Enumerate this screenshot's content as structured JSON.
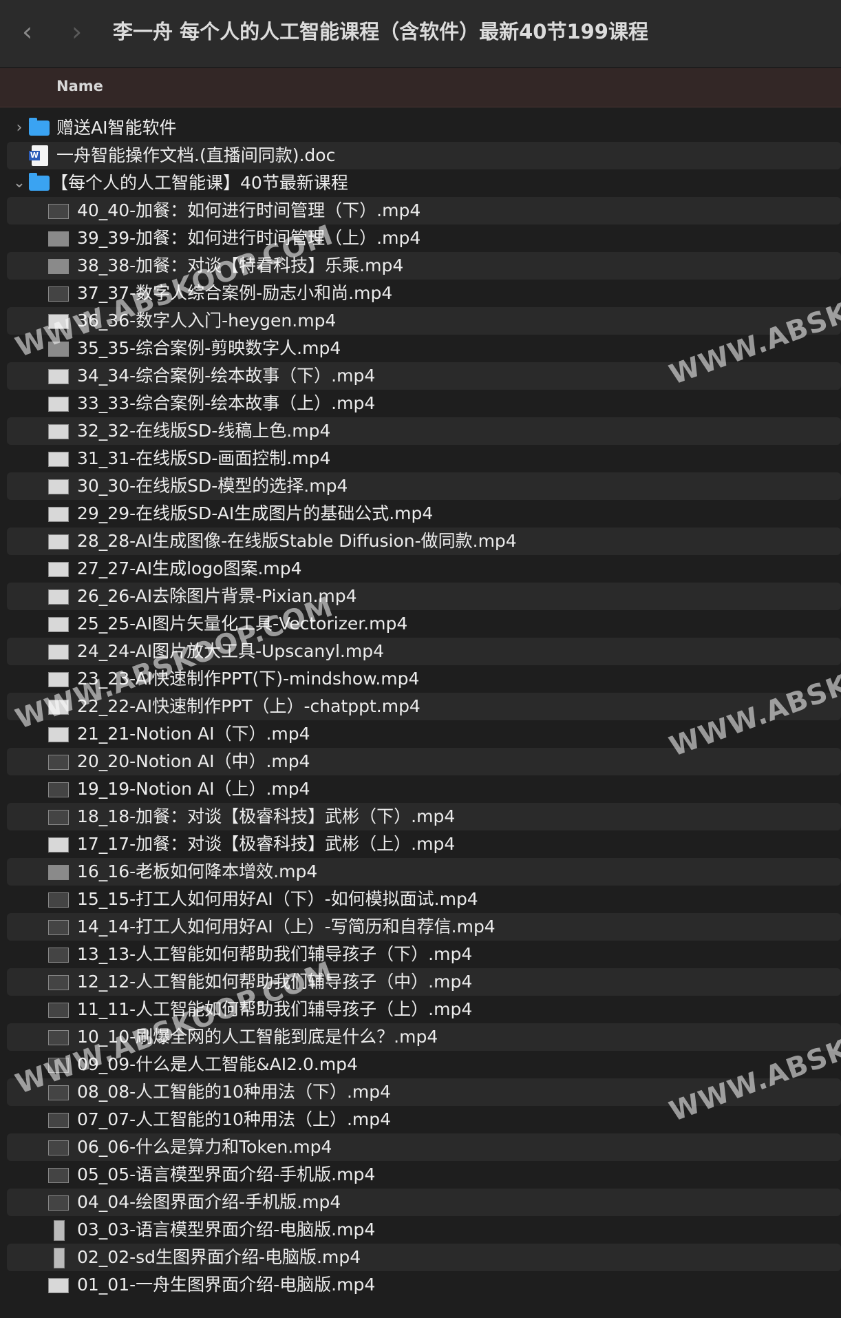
{
  "window": {
    "title": "李一舟 每个人的人工智能课程（含软件）最新40节199课程",
    "back_glyph": "‹",
    "forward_glyph": "›"
  },
  "header": {
    "name_column": "Name"
  },
  "rows": [
    {
      "label": "赠送AI智能软件",
      "kind": "folder",
      "disclosure": "›"
    },
    {
      "label": "一舟智能操作文档.(直播间同款).doc",
      "kind": "doc"
    },
    {
      "label": "【每个人的人工智能课】40节最新课程",
      "kind": "folder",
      "disclosure": "⌄"
    },
    {
      "label": "40_40-加餐：如何进行时间管理（下）.mp4",
      "kind": "video"
    },
    {
      "label": "39_39-加餐：如何进行时间管理（上）.mp4",
      "kind": "video"
    },
    {
      "label": "38_38-加餐：对谈【特看科技】乐乘.mp4",
      "kind": "video"
    },
    {
      "label": "37_37-数字人综合案例-励志小和尚.mp4",
      "kind": "video"
    },
    {
      "label": "36_36-数字人入门-heygen.mp4",
      "kind": "video"
    },
    {
      "label": "35_35-综合案例-剪映数字人.mp4",
      "kind": "video"
    },
    {
      "label": "34_34-综合案例-绘本故事（下）.mp4",
      "kind": "video"
    },
    {
      "label": "33_33-综合案例-绘本故事（上）.mp4",
      "kind": "video"
    },
    {
      "label": "32_32-在线版SD-线稿上色.mp4",
      "kind": "video"
    },
    {
      "label": "31_31-在线版SD-画面控制.mp4",
      "kind": "video"
    },
    {
      "label": "30_30-在线版SD-模型的选择.mp4",
      "kind": "video"
    },
    {
      "label": "29_29-在线版SD-AI生成图片的基础公式.mp4",
      "kind": "video"
    },
    {
      "label": "28_28-AI生成图像-在线版Stable Diffusion-做同款.mp4",
      "kind": "video"
    },
    {
      "label": "27_27-AI生成logo图案.mp4",
      "kind": "video"
    },
    {
      "label": "26_26-AI去除图片背景-Pixian.mp4",
      "kind": "video"
    },
    {
      "label": "25_25-AI图片矢量化工具-Vectorizer.mp4",
      "kind": "video"
    },
    {
      "label": "24_24-AI图片放大工具-Upscanyl.mp4",
      "kind": "video"
    },
    {
      "label": "23_23-AI快速制作PPT(下)-mindshow.mp4",
      "kind": "video"
    },
    {
      "label": "22_22-AI快速制作PPT（上）-chatppt.mp4",
      "kind": "video"
    },
    {
      "label": "21_21-Notion AI（下）.mp4",
      "kind": "video"
    },
    {
      "label": "20_20-Notion AI（中）.mp4",
      "kind": "video"
    },
    {
      "label": "19_19-Notion AI（上）.mp4",
      "kind": "video"
    },
    {
      "label": "18_18-加餐：对谈【极睿科技】武彬（下）.mp4",
      "kind": "video"
    },
    {
      "label": "17_17-加餐：对谈【极睿科技】武彬（上）.mp4",
      "kind": "video"
    },
    {
      "label": "16_16-老板如何降本增效.mp4",
      "kind": "video"
    },
    {
      "label": "15_15-打工人如何用好AI（下）-如何模拟面试.mp4",
      "kind": "video"
    },
    {
      "label": "14_14-打工人如何用好AI（上）-写简历和自荐信.mp4",
      "kind": "video"
    },
    {
      "label": "13_13-人工智能如何帮助我们辅导孩子（下）.mp4",
      "kind": "video"
    },
    {
      "label": "12_12-人工智能如何帮助我们辅导孩子（中）.mp4",
      "kind": "video"
    },
    {
      "label": "11_11-人工智能如何帮助我们辅导孩子（上）.mp4",
      "kind": "video"
    },
    {
      "label": "10_10-刷爆全网的人工智能到底是什么？.mp4",
      "kind": "video"
    },
    {
      "label": "09_09-什么是人工智能&AI2.0.mp4",
      "kind": "video"
    },
    {
      "label": "08_08-人工智能的10种用法（下）.mp4",
      "kind": "video"
    },
    {
      "label": "07_07-人工智能的10种用法（上）.mp4",
      "kind": "video"
    },
    {
      "label": "06_06-什么是算力和Token.mp4",
      "kind": "video"
    },
    {
      "label": "05_05-语言模型界面介绍-手机版.mp4",
      "kind": "video"
    },
    {
      "label": "04_04-绘图界面介绍-手机版.mp4",
      "kind": "video"
    },
    {
      "label": "03_03-语言模型界面介绍-电脑版.mp4",
      "kind": "video"
    },
    {
      "label": "02_02-sd生图界面介绍-电脑版.mp4",
      "kind": "video"
    },
    {
      "label": "01_01-一舟生图界面介绍-电脑版.mp4",
      "kind": "video"
    }
  ],
  "watermark": "WWW.ABSKOOP.COM"
}
